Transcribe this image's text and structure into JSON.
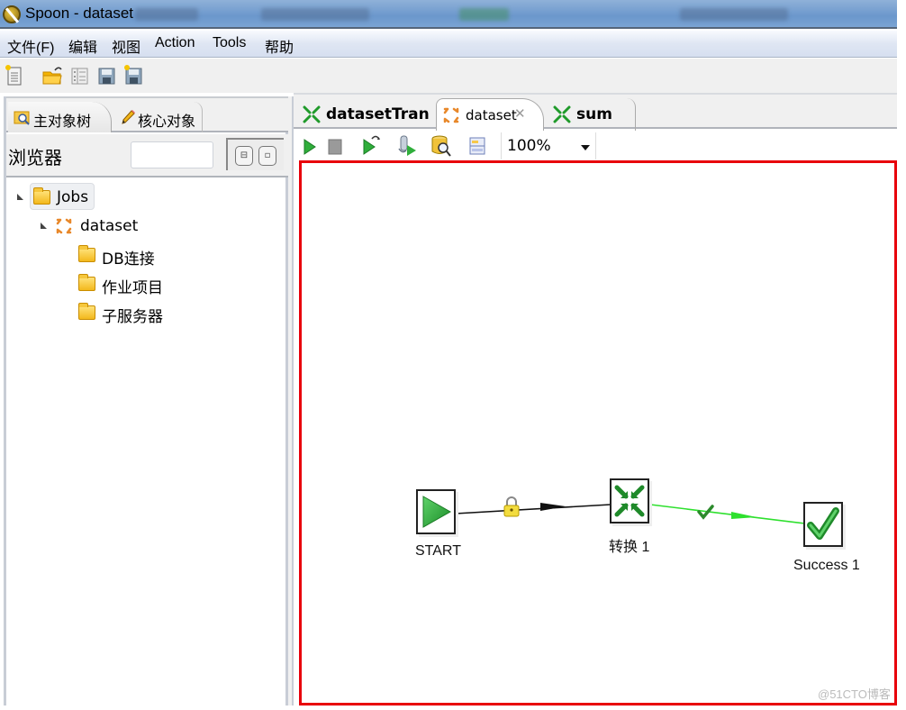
{
  "window": {
    "title": "Spoon - dataset"
  },
  "menubar": {
    "items": [
      "文件(F)",
      "编辑",
      "视图",
      "Action",
      "Tools",
      "帮助"
    ]
  },
  "toolbar": {
    "icons": [
      "new-file-icon",
      "open-folder-icon",
      "explorer-icon",
      "save-icon",
      "save-as-icon"
    ]
  },
  "left_panel": {
    "tabs": [
      {
        "label": "主对象树",
        "icon": "search-folder-icon",
        "active": true
      },
      {
        "label": "核心对象",
        "icon": "pencil-icon",
        "active": false
      }
    ],
    "browser_label": "浏览器",
    "search": {
      "value": "",
      "placeholder": ""
    },
    "view_buttons": [
      "tree-view-icon",
      "collapse-view-icon"
    ],
    "tree": [
      {
        "label": "Jobs",
        "level": 0,
        "expanded": true,
        "icon": "folder-icon"
      },
      {
        "label": "dataset",
        "level": 1,
        "expanded": true,
        "icon": "job-icon"
      },
      {
        "label": "DB连接",
        "level": 2,
        "expandable": false,
        "icon": "folder-icon"
      },
      {
        "label": "作业项目",
        "level": 2,
        "expandable": true,
        "expanded": false,
        "icon": "folder-icon"
      },
      {
        "label": "子服务器",
        "level": 2,
        "expandable": false,
        "icon": "folder-icon"
      }
    ]
  },
  "editor": {
    "tabs": [
      {
        "label": "datasetTran",
        "icon": "transformation-icon",
        "active": false
      },
      {
        "label": "dataset",
        "icon": "job-icon",
        "active": true,
        "closable": true
      },
      {
        "label": "sum",
        "icon": "transformation-icon",
        "active": false
      }
    ],
    "toolbar": {
      "icons": [
        "run-icon",
        "stop-icon",
        "replay-icon",
        "check-icon",
        "sql-search-icon",
        "explore-db-icon"
      ],
      "zoom": "100%"
    },
    "canvas": {
      "nodes": [
        {
          "id": "start",
          "label": "START",
          "icon": "start-play-icon"
        },
        {
          "id": "trans",
          "label": "转换 1",
          "icon": "transformation-icon"
        },
        {
          "id": "success",
          "label": "Success 1",
          "icon": "success-check-icon"
        }
      ],
      "hops": [
        {
          "from": "START",
          "to": "转换 1",
          "type": "unconditional",
          "color": "#111111",
          "icon": "lock-icon"
        },
        {
          "from": "转换 1",
          "to": "Success 1",
          "type": "on-success",
          "color": "#22dd22",
          "icon": "check-icon"
        }
      ],
      "highlight_color": "#e8000b"
    }
  },
  "watermark": "@51CTO博客"
}
